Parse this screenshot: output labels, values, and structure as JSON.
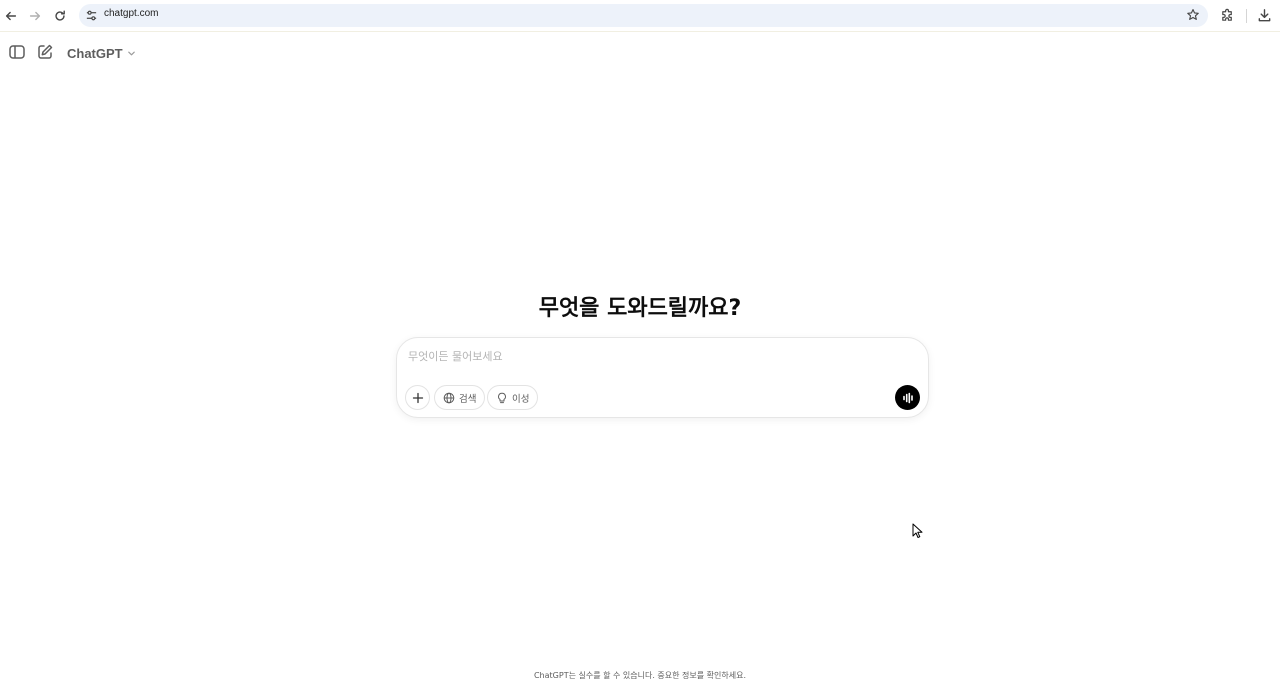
{
  "browser": {
    "url": "chatgpt.com"
  },
  "header": {
    "model_name": "ChatGPT"
  },
  "main": {
    "greeting": "무엇을 도와드릴까요?"
  },
  "composer": {
    "placeholder": "무엇이든 물어보세요",
    "search_label": "검색",
    "reason_label": "이성"
  },
  "footer": {
    "disclaimer": "ChatGPT는 실수를 할 수 있습니다. 중요한 정보를 확인하세요."
  },
  "icons": {
    "back": "arrow-left-icon",
    "forward": "arrow-right-icon",
    "reload": "reload-icon",
    "site_settings": "tune-icon",
    "bookmark": "star-icon",
    "extensions": "puzzle-icon",
    "downloads": "download-icon",
    "sidebar_toggle": "sidebar-icon",
    "new_chat": "compose-icon",
    "attach": "plus-icon",
    "search": "globe-icon",
    "reason": "lightbulb-icon",
    "voice": "voice-waveform-icon"
  },
  "colors": {
    "omnibox_bg": "#edf2fa",
    "voice_button_bg": "#000000",
    "text_primary": "#0d0d0d",
    "text_secondary": "#5d5d5d"
  }
}
